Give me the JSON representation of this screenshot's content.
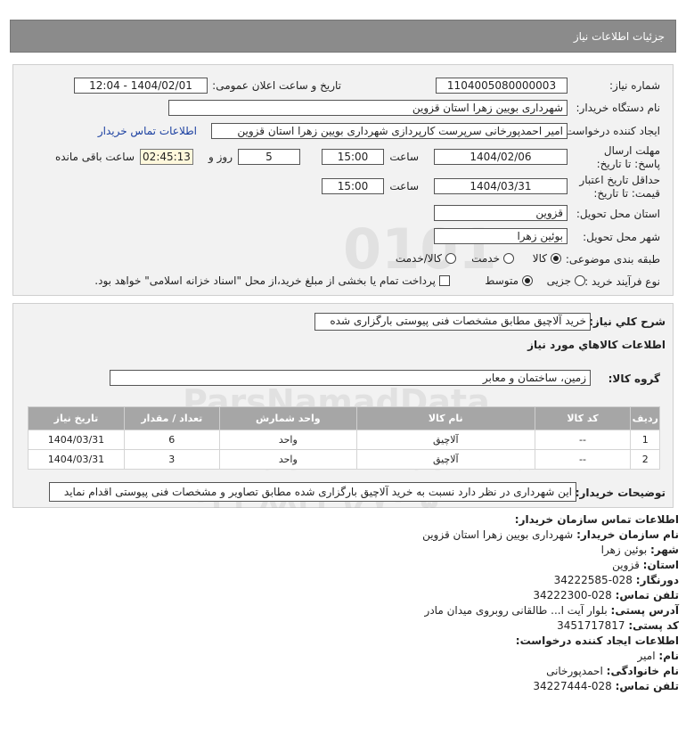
{
  "header": {
    "title": "جزئیات اطلاعات نیاز"
  },
  "form": {
    "need_number_label": "شماره نیاز:",
    "need_number": "1104005080000003",
    "announce_label": "تاریخ و ساعت اعلان عمومی:",
    "announce_value": "1404/02/01 - 12:04",
    "buyer_org_label": "نام دستگاه خریدار:",
    "buyer_org": "شهرداری بویین زهرا استان قزوین",
    "creator_label": "ایجاد کننده درخواست:",
    "creator": "امیر احمدپورخانی سرپرست کارپردازی شهرداری بویین زهرا استان قزوین",
    "contact_link": "اطلاعات تماس خریدار",
    "deadline_label": "مهلت ارسال پاسخ: تا تاریخ:",
    "deadline_date": "1404/02/06",
    "time_label": "ساعت",
    "deadline_time": "15:00",
    "days_value": "5",
    "days_label": "روز و",
    "countdown": "02:45:13",
    "remaining_label": "ساعت باقی مانده",
    "validity_label": "حداقل تاریخ اعتبار قیمت: تا تاریخ:",
    "validity_date": "1404/03/31",
    "validity_time": "15:00",
    "province_label": "استان محل تحویل:",
    "province": "قزوین",
    "city_label": "شهر محل تحویل:",
    "city": "بوئین زهرا",
    "category_label": "طبقه بندی موضوعی:",
    "category_options": [
      "کالا",
      "خدمت",
      "کالا/خدمت"
    ],
    "process_label": "نوع فرآیند خرید :",
    "process_options": [
      "جزیی",
      "متوسط"
    ],
    "treasury_text": "پرداخت تمام یا بخشی از مبلغ خرید،از محل \"اسناد خزانه اسلامی\" خواهد بود."
  },
  "details": {
    "summary_label": "شرح کلي نياز:",
    "summary": "خرید آلاچیق مطابق مشخصات فنی پیوستی بارگزاری شده",
    "goods_info_title": "اطلاعات کالاهاي مورد نياز",
    "goods_group_label": "گروه کالا:",
    "goods_group": "زمین، ساختمان  و معابر",
    "table_headers": [
      "ردیف",
      "کد کالا",
      "نام کالا",
      "واحد شمارش",
      "تعداد / مقدار",
      "تاریخ نیاز"
    ],
    "rows": [
      {
        "idx": "1",
        "code": "--",
        "name": "آلاچیق",
        "unit": "واحد",
        "qty": "6",
        "date": "1404/03/31"
      },
      {
        "idx": "2",
        "code": "--",
        "name": "آلاچیق",
        "unit": "واحد",
        "qty": "3",
        "date": "1404/03/31"
      }
    ],
    "buyer_notes_label": "توضیحات خریدار:",
    "buyer_notes": "این شهرداری در نظر دارد نسبت به خرید آلاچیق بارگزاری شده مطابق تصاویر و مشخصات فنی پیوستی اقدام نماید"
  },
  "contact": {
    "title1": "اطلاعات تماس سازمان خریدار:",
    "org_label": "نام سازمان خریدار:",
    "org": "شهرداری بویین زهرا استان قزوین",
    "city_label": "شهر:",
    "city": "بوئین زهرا",
    "province_label": "استان:",
    "province": "قزوین",
    "fax_label": "دورنگار:",
    "fax": "028-34222585",
    "phone_label": "تلفن تماس:",
    "phone": "028-34222300",
    "address_label": "آدرس پستی:",
    "address": "بلوار آیت ا... طالقانی روبروی میدان مادر",
    "postal_label": "کد پستی:",
    "postal": "3451717817",
    "title2": "اطلاعات ایجاد کننده درخواست:",
    "first_name_label": "نام:",
    "first_name": "امیر",
    "last_name_label": "نام خانوادگی:",
    "last_name": "احمدپورخانی",
    "creator_phone_label": "تلفن تماس:",
    "creator_phone": "028-34227444"
  },
  "watermark": {
    "line1": "ParsNamadData",
    "line2": "مرکز فراوری اطلاعات پارس نماد داده ها",
    "line3": "پایگاه اطلاع رسانی مناقصه و مزایده",
    "line4": "۰۲۱-۸۸۳۴۹۶۷۰-۵"
  }
}
